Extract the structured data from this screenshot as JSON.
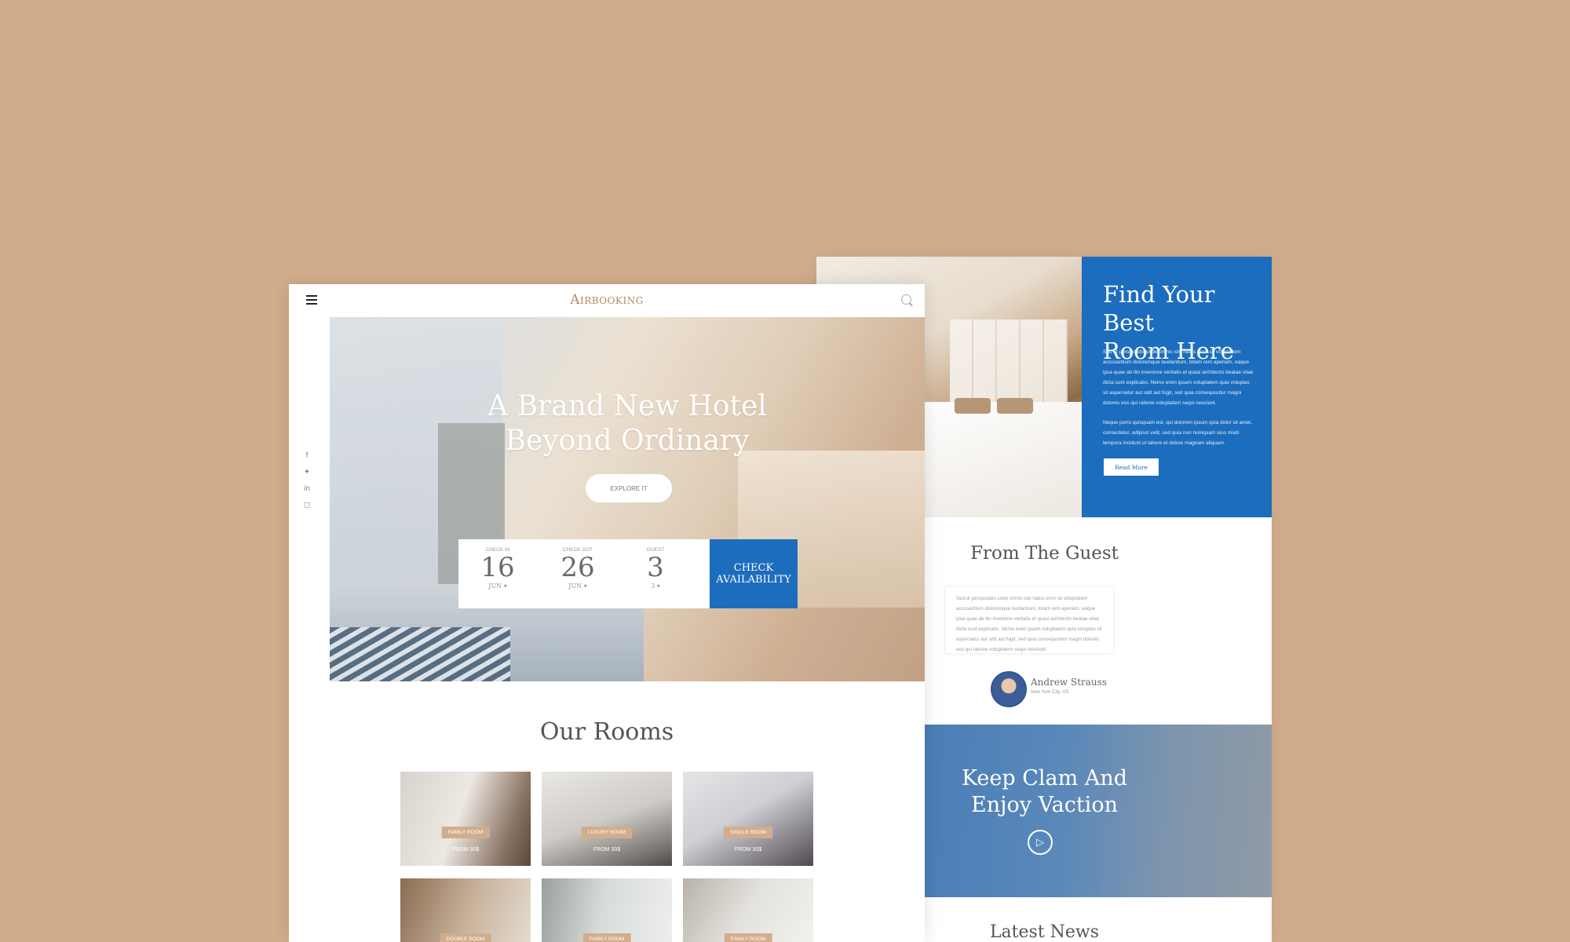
{
  "colors": {
    "background": "#d2ad8c",
    "accent_blue": "#1c6dbe",
    "brand_gold": "#b58a62"
  },
  "header": {
    "brand": "Airbooking",
    "menu_icon": "hamburger-icon",
    "search_icon": "search-icon"
  },
  "hero": {
    "title_line1": "A Brand New Hotel",
    "title_line2": "Beyond Ordinary",
    "cta": "EXPLORE IT"
  },
  "booking": {
    "check_in": {
      "label": "CHECK IN",
      "day": "16",
      "month": "JUN ▾"
    },
    "check_out": {
      "label": "CHECK OUT",
      "day": "26",
      "month": "JUN ▾"
    },
    "guest": {
      "label": "GUEST",
      "count": "3",
      "sub": "3 ▾"
    },
    "button_line1": "CHECK",
    "button_line2": "AVAILABILITY"
  },
  "social": [
    "f",
    "t",
    "in",
    "ig"
  ],
  "rooms": {
    "title": "Our Rooms",
    "items": [
      {
        "tag": "FAMILY ROOM",
        "price": "FROM 30$"
      },
      {
        "tag": "LUXURY ROOM",
        "price": "FROM 30$"
      },
      {
        "tag": "SINGLE ROOM",
        "price": "FROM 30$"
      },
      {
        "tag": "DOUBLE ROOM",
        "price": ""
      },
      {
        "tag": "FAMILY ROOM",
        "price": ""
      },
      {
        "tag": "FAMILY ROOM",
        "price": ""
      }
    ]
  },
  "promo": {
    "title_line1": "Find Your Best",
    "title_line2": "Room Here",
    "para1": "Sed ut perspiciatis unde omnis iste natus error sit voluptatem accusantium doloremque laudantium, totam rem aperiam, eaque ipsa quae ab illo inventore veritatis et quasi architecto beatae vitae dicta sunt explicabo. Nemo enim ipsam voluptatem quia voluptas sit aspernatur aut odit aut fugit, sed quia consequuntur magni dolores eos qui ratione voluptatem sequi nesciunt.",
    "para2": "Neque porro quisquam est, qui dolorem ipsum quia dolor sit amet, consectetur, adipisci velit, sed quia non numquam eius modi tempora incidunt ut labore et dolore magnam aliquam.",
    "button": "Read More"
  },
  "testimonial": {
    "title": "From The Guest",
    "quote": "Sed ut perspiciatis unde omnis iste natus error sit voluptatem accusantium doloremque laudantium, totam rem aperiam, eaque ipsa quae ab illo inventore veritatis et quasi architecto beatae vitae dicta sunt explicabo. Nemo enim ipsam voluptatem quia voluptas sit aspernatur aut odit aut fugit, sed quia consequuntur magni dolores eos qui ratione voluptatem sequi nesciunt.",
    "author": "Andrew Strauss",
    "author_sub": "New York City, US"
  },
  "video": {
    "title_line1": "Keep Clam And",
    "title_line2": "Enjoy Vaction",
    "play_icon": "play-icon"
  },
  "news": {
    "title": "Latest News"
  }
}
